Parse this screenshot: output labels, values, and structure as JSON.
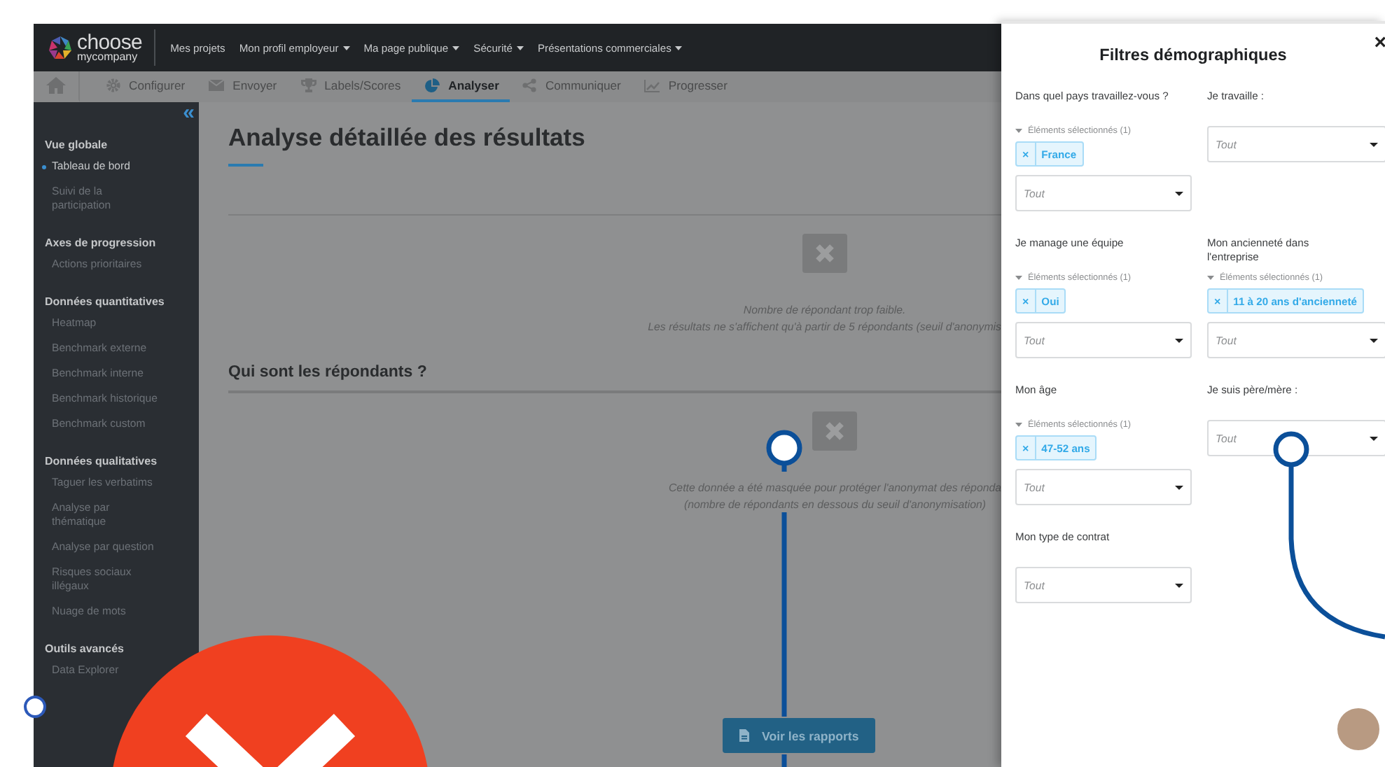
{
  "logo": {
    "line1": "choose",
    "line2": "mycompany"
  },
  "top_menu": [
    {
      "label": "Mes projets",
      "has_menu": false
    },
    {
      "label": "Mon profil employeur",
      "has_menu": true
    },
    {
      "label": "Ma page publique",
      "has_menu": true
    },
    {
      "label": "Sécurité",
      "has_menu": true
    },
    {
      "label": "Présentations commerciales",
      "has_menu": true
    }
  ],
  "tabs": [
    {
      "kind": "home",
      "selected": false
    },
    {
      "kind": "gear",
      "label": "Configurer",
      "selected": false
    },
    {
      "kind": "envelope",
      "label": "Envoyer",
      "selected": false
    },
    {
      "kind": "trophy",
      "label": "Labels/Scores",
      "selected": false
    },
    {
      "kind": "pie",
      "label": "Analyser",
      "selected": true
    },
    {
      "kind": "share",
      "label": "Communiquer",
      "selected": false
    },
    {
      "kind": "chart",
      "label": "Progresser",
      "selected": false
    }
  ],
  "sidebar": {
    "collapse": "«",
    "sections": [
      {
        "title": "Vue globale",
        "items": [
          {
            "label": "Tableau de bord",
            "selected": true
          },
          {
            "label": "Suivi de la participation",
            "selected": false
          }
        ]
      },
      {
        "title": "Axes de progression",
        "items": [
          {
            "label": "Actions prioritaires",
            "selected": false
          }
        ]
      },
      {
        "title": "Données quantitatives",
        "items": [
          {
            "label": "Heatmap",
            "selected": false
          },
          {
            "label": "Benchmark externe",
            "selected": false
          },
          {
            "label": "Benchmark interne",
            "selected": false
          },
          {
            "label": "Benchmark historique",
            "selected": false
          },
          {
            "label": "Benchmark custom",
            "selected": false
          }
        ]
      },
      {
        "title": "Données qualitatives",
        "items": [
          {
            "label": "Taguer les verbatims",
            "selected": false
          },
          {
            "label": "Analyse par thématique",
            "selected": false
          },
          {
            "label": "Analyse par question",
            "selected": false
          },
          {
            "label": "Risques sociaux illégaux",
            "selected": false
          },
          {
            "label": "Nuage de mots",
            "selected": false
          }
        ]
      },
      {
        "title": "Outils avancés",
        "items": [
          {
            "label": "Data Explorer",
            "selected": false
          }
        ]
      }
    ]
  },
  "main": {
    "title": "Analyse détaillée des résultats",
    "blocks": [
      {
        "kind": "notice",
        "lines": [
          "Nombre de répondant trop faible.",
          "Les résultats ne s'affichent qu'à partir de 5 répondants (seuil d'anonymis"
        ]
      },
      {
        "kind": "heading",
        "text": "Qui sont les répondants ?"
      },
      {
        "kind": "notice",
        "lines": [
          "Cette donnée a été masquée pour protéger l'anonymat des réponda",
          "(nombre de répondants en dessous du seuil d'anonymisation)"
        ]
      }
    ],
    "button": "Voir les rapports"
  },
  "filter_panel": {
    "title": "Filtres démographiques",
    "close": "×",
    "filters": [
      {
        "label": "Dans quel pays travaillez-vous ?",
        "selected_header": "Éléments sélectionnés (1)",
        "chips": [
          {
            "remove": "×",
            "label": "France"
          }
        ],
        "placeholder": "Tout"
      },
      {
        "label": "Je travaille :",
        "placeholder": "Tout"
      },
      {
        "label": "Je manage une équipe",
        "selected_header": "Éléments sélectionnés (1)",
        "chips": [
          {
            "remove": "×",
            "label": "Oui"
          }
        ],
        "placeholder": "Tout"
      },
      {
        "label": "Mon ancienneté dans l'entreprise",
        "selected_header": "Éléments sélectionnés (1)",
        "chips": [
          {
            "remove": "×",
            "label": "11 à 20 ans d'ancienneté"
          }
        ],
        "placeholder": "Tout"
      },
      {
        "label": "Mon âge",
        "selected_header": "Éléments sélectionnés (1)",
        "chips": [
          {
            "remove": "×",
            "label": "47-52 ans"
          }
        ],
        "placeholder": "Tout"
      },
      {
        "label": "Je suis père/mère :",
        "placeholder": "Tout"
      },
      {
        "label": "Mon type de contrat",
        "placeholder": "Tout"
      }
    ]
  }
}
